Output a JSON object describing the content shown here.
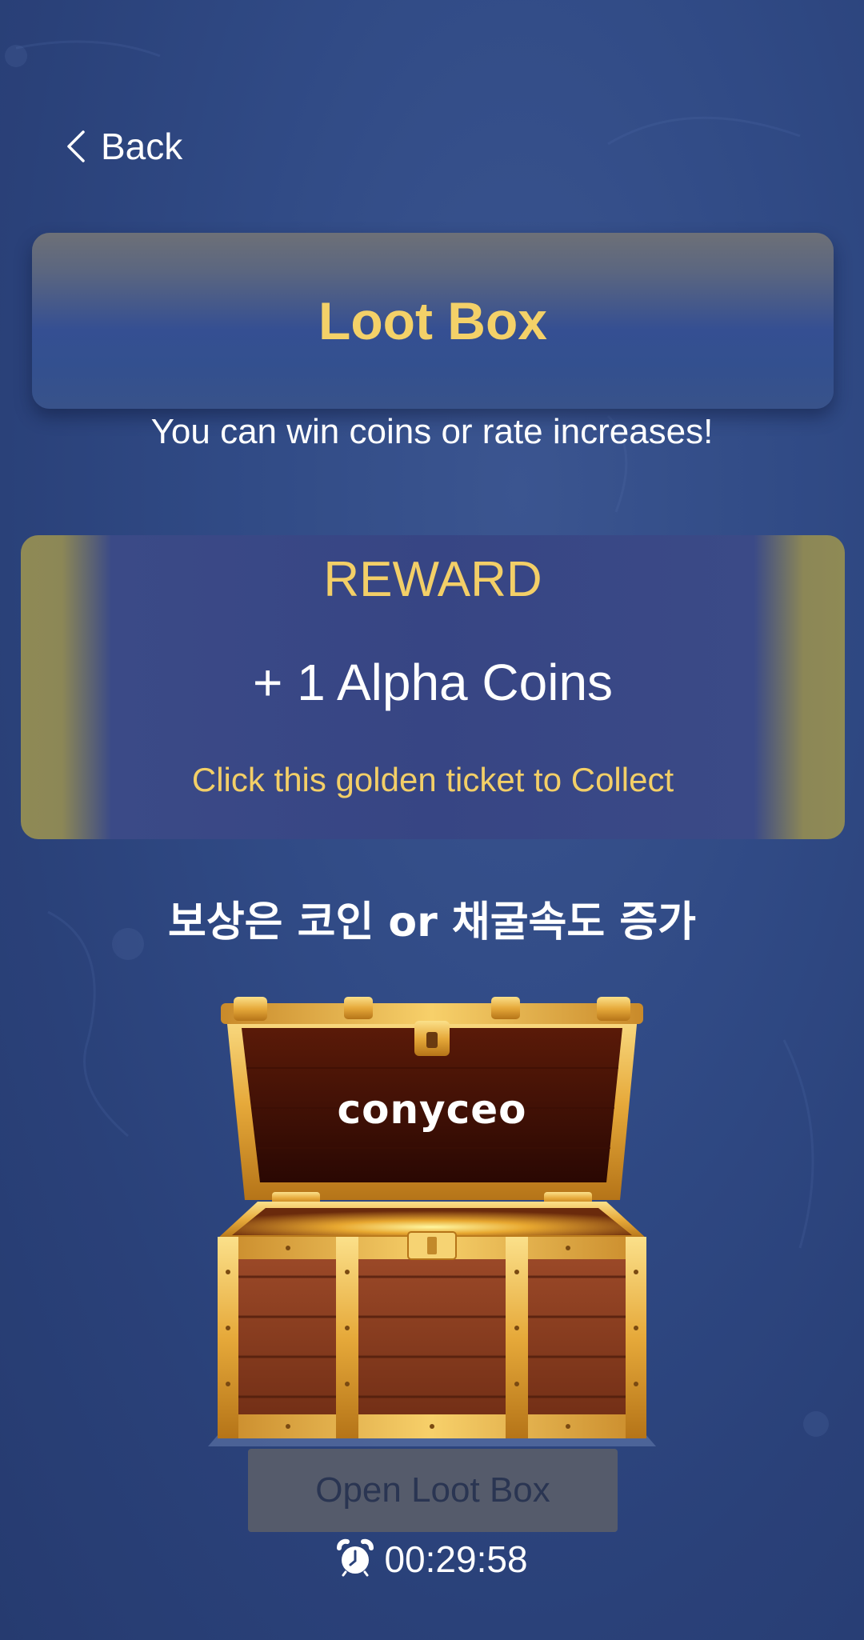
{
  "nav": {
    "back_label": "Back"
  },
  "header": {
    "title": "Loot Box",
    "subtitle": "You can win coins or rate increases!"
  },
  "reward": {
    "label": "REWARD",
    "amount": "+ 1 Alpha Coins",
    "hint": "Click this golden ticket to Collect"
  },
  "caption": "보상은 코인 or 채굴속도 증가",
  "chest": {
    "owner_name": "conyceo"
  },
  "actions": {
    "open_label": "Open Loot Box"
  },
  "timer": {
    "value": "00:29:58",
    "icon": "alarm-clock-icon"
  },
  "colors": {
    "background": "#304a85",
    "accent_gold": "#f3cf67",
    "button_disabled": "#555b6b"
  }
}
